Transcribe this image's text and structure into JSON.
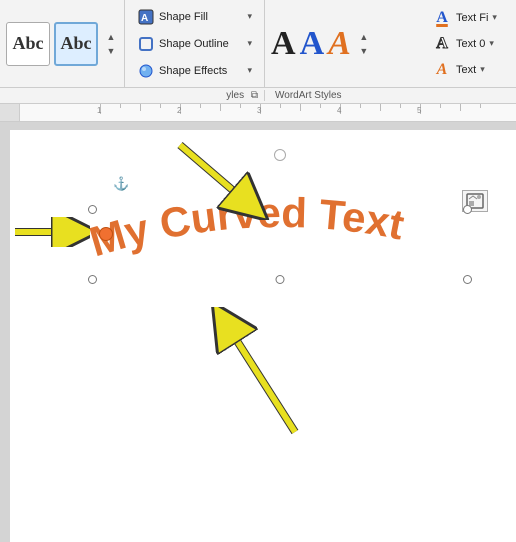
{
  "ribbon": {
    "style_buttons": [
      {
        "label": "Abc",
        "active": false
      },
      {
        "label": "Abc",
        "active": true
      }
    ],
    "shape_options": [
      {
        "icon": "🎨",
        "label": "Shape Fill",
        "has_arrow": true
      },
      {
        "icon": "📐",
        "label": "Shape Outline",
        "has_arrow": true
      },
      {
        "icon": "✨",
        "label": "Shape Effects",
        "has_arrow": true
      }
    ],
    "wordart_label": "WordArt Styles",
    "wordart_letters": [
      {
        "char": "A",
        "style": "plain"
      },
      {
        "char": "A",
        "style": "blue"
      },
      {
        "char": "A",
        "style": "shadow"
      }
    ],
    "text_options": [
      {
        "icon": "A",
        "label": "Text Fi",
        "has_arrow": false
      },
      {
        "icon": "A",
        "label": "Text 0",
        "has_arrow": false
      },
      {
        "icon": "A",
        "label": "Text",
        "has_arrow": false
      }
    ]
  },
  "section_labels": {
    "left": "yles",
    "right": "WordArt Styles"
  },
  "canvas": {
    "curved_text": "My Curved Text",
    "arrows": [
      "down-diagonal",
      "right",
      "up-diagonal"
    ]
  }
}
